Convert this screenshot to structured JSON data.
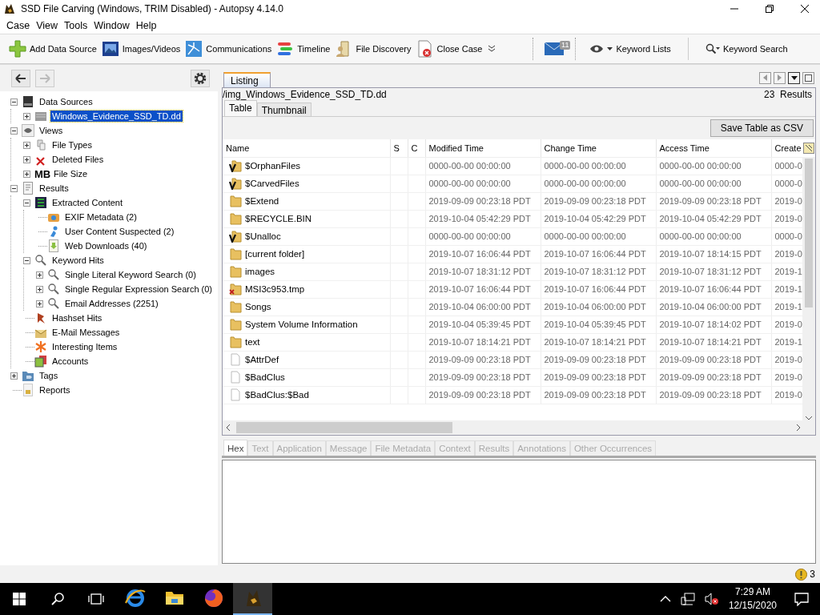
{
  "window": {
    "title": "SSD File Carving (Windows, TRIM Disabled) - Autopsy 4.14.0"
  },
  "menu": [
    "Case",
    "View",
    "Tools",
    "Window",
    "Help"
  ],
  "toolbar": {
    "buttons": [
      {
        "label": "Add Data Source"
      },
      {
        "label": "Images/Videos"
      },
      {
        "label": "Communications"
      },
      {
        "label": "Timeline"
      },
      {
        "label": "File Discovery"
      },
      {
        "label": "Close Case"
      }
    ],
    "notification_count": "11",
    "keyword_lists": "Keyword Lists",
    "keyword_search": "Keyword Search"
  },
  "tree": [
    {
      "label": "Data Sources",
      "selected": false,
      "expanded": true,
      "children": [
        {
          "label": "Windows_Evidence_SSD_TD.dd",
          "selected": true,
          "expanded": false
        }
      ]
    },
    {
      "label": "Views",
      "selected": false,
      "expanded": true,
      "children": [
        {
          "label": "File Types",
          "selected": false,
          "expanded": false
        },
        {
          "label": "Deleted Files",
          "selected": false,
          "expanded": false
        },
        {
          "label": "File Size",
          "unit": "MB",
          "selected": false,
          "expanded": false
        }
      ]
    },
    {
      "label": "Results",
      "selected": false,
      "expanded": true,
      "children": [
        {
          "label": "Extracted Content",
          "selected": false,
          "expanded": true,
          "children": [
            {
              "label": "EXIF Metadata (2)",
              "selected": false
            },
            {
              "label": "User Content Suspected (2)",
              "selected": false
            },
            {
              "label": "Web Downloads (40)",
              "selected": false
            }
          ]
        },
        {
          "label": "Keyword Hits",
          "selected": false,
          "expanded": true,
          "children": [
            {
              "label": "Single Literal Keyword Search (0)",
              "selected": false,
              "expanded": false
            },
            {
              "label": "Single Regular Expression Search (0)",
              "selected": false,
              "expanded": false
            },
            {
              "label": "Email Addresses (2251)",
              "selected": false,
              "expanded": false
            }
          ]
        },
        {
          "label": "Hashset Hits",
          "selected": false
        },
        {
          "label": "E-Mail Messages",
          "selected": false
        },
        {
          "label": "Interesting Items",
          "selected": false
        },
        {
          "label": "Accounts",
          "selected": false
        }
      ]
    },
    {
      "label": "Tags",
      "selected": false,
      "expanded": false
    },
    {
      "label": "Reports",
      "selected": false
    }
  ],
  "listing": {
    "tab": "Listing",
    "path": "/img_Windows_Evidence_SSD_TD.dd",
    "results_count": "23",
    "results_label": "Results",
    "view_tabs": [
      {
        "label": "Table",
        "selected": true
      },
      {
        "label": "Thumbnail",
        "selected": false
      }
    ],
    "export_button": "Save Table as CSV",
    "columns": [
      "Name",
      "S",
      "C",
      "Modified Time",
      "Change Time",
      "Access Time",
      "Create"
    ],
    "rows": [
      {
        "kind": "virtual",
        "name": "$OrphanFiles",
        "modified": "0000-00-00 00:00:00",
        "changed": "0000-00-00 00:00:00",
        "accessed": "0000-00-00 00:00:00",
        "created": "0000-0"
      },
      {
        "kind": "virtual",
        "name": "$CarvedFiles",
        "modified": "0000-00-00 00:00:00",
        "changed": "0000-00-00 00:00:00",
        "accessed": "0000-00-00 00:00:00",
        "created": "0000-0"
      },
      {
        "kind": "folder",
        "name": "$Extend",
        "modified": "2019-09-09 00:23:18 PDT",
        "changed": "2019-09-09 00:23:18 PDT",
        "accessed": "2019-09-09 00:23:18 PDT",
        "created": "2019-0"
      },
      {
        "kind": "folder",
        "name": "$RECYCLE.BIN",
        "modified": "2019-10-04 05:42:29 PDT",
        "changed": "2019-10-04 05:42:29 PDT",
        "accessed": "2019-10-04 05:42:29 PDT",
        "created": "2019-0"
      },
      {
        "kind": "virtual",
        "name": "$Unalloc",
        "modified": "0000-00-00 00:00:00",
        "changed": "0000-00-00 00:00:00",
        "accessed": "0000-00-00 00:00:00",
        "created": "0000-0"
      },
      {
        "kind": "folder",
        "name": "[current folder]",
        "modified": "2019-10-07 16:06:44 PDT",
        "changed": "2019-10-07 16:06:44 PDT",
        "accessed": "2019-10-07 18:14:15 PDT",
        "created": "2019-0"
      },
      {
        "kind": "folder",
        "name": "images",
        "modified": "2019-10-07 18:31:12 PDT",
        "changed": "2019-10-07 18:31:12 PDT",
        "accessed": "2019-10-07 18:31:12 PDT",
        "created": "2019-1"
      },
      {
        "kind": "deleted",
        "name": "MSI3c953.tmp",
        "modified": "2019-10-07 16:06:44 PDT",
        "changed": "2019-10-07 16:06:44 PDT",
        "accessed": "2019-10-07 16:06:44 PDT",
        "created": "2019-1"
      },
      {
        "kind": "folder",
        "name": "Songs",
        "modified": "2019-10-04 06:00:00 PDT",
        "changed": "2019-10-04 06:00:00 PDT",
        "accessed": "2019-10-04 06:00:00 PDT",
        "created": "2019-1"
      },
      {
        "kind": "folder",
        "name": "System Volume Information",
        "modified": "2019-10-04 05:39:45 PDT",
        "changed": "2019-10-04 05:39:45 PDT",
        "accessed": "2019-10-07 18:14:02 PDT",
        "created": "2019-0"
      },
      {
        "kind": "folder",
        "name": "text",
        "modified": "2019-10-07 18:14:21 PDT",
        "changed": "2019-10-07 18:14:21 PDT",
        "accessed": "2019-10-07 18:14:21 PDT",
        "created": "2019-1"
      },
      {
        "kind": "file",
        "name": "$AttrDef",
        "modified": "2019-09-09 00:23:18 PDT",
        "changed": "2019-09-09 00:23:18 PDT",
        "accessed": "2019-09-09 00:23:18 PDT",
        "created": "2019-0"
      },
      {
        "kind": "file",
        "name": "$BadClus",
        "modified": "2019-09-09 00:23:18 PDT",
        "changed": "2019-09-09 00:23:18 PDT",
        "accessed": "2019-09-09 00:23:18 PDT",
        "created": "2019-0"
      },
      {
        "kind": "file",
        "name": "$BadClus:$Bad",
        "modified": "2019-09-09 00:23:18 PDT",
        "changed": "2019-09-09 00:23:18 PDT",
        "accessed": "2019-09-09 00:23:18 PDT",
        "created": "2019-0"
      }
    ]
  },
  "viewer": {
    "tabs": [
      {
        "label": "Hex",
        "selected": true,
        "disabled": false
      },
      {
        "label": "Text",
        "selected": false,
        "disabled": true
      },
      {
        "label": "Application",
        "selected": false,
        "disabled": true
      },
      {
        "label": "Message",
        "selected": false,
        "disabled": true
      },
      {
        "label": "File Metadata",
        "selected": false,
        "disabled": true
      },
      {
        "label": "Context",
        "selected": false,
        "disabled": true
      },
      {
        "label": "Results",
        "selected": false,
        "disabled": true
      },
      {
        "label": "Annotations",
        "selected": false,
        "disabled": true
      },
      {
        "label": "Other Occurrences",
        "selected": false,
        "disabled": true
      }
    ]
  },
  "status_bar": {
    "notice_count": "3"
  },
  "taskbar": {
    "apps": [
      {
        "selected": false
      },
      {
        "selected": false
      },
      {
        "selected": false
      },
      {
        "selected": true
      }
    ],
    "time": "7:29 AM",
    "date": "12/15/2020"
  }
}
